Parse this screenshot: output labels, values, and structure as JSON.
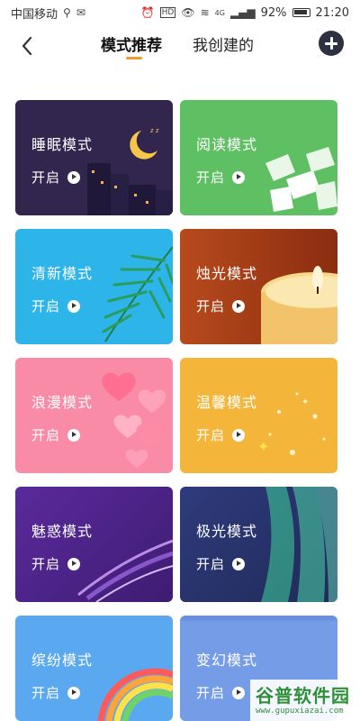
{
  "status_bar": {
    "carrier": "中国移动",
    "hd": "HD",
    "signal": "4G",
    "battery": "92%",
    "time": "21:20"
  },
  "nav": {
    "tab_recommend": "模式推荐",
    "tab_created": "我创建的",
    "accent_color": "#f39b2a"
  },
  "cards": [
    {
      "title": "睡眠模式",
      "start": "开启",
      "color": "#32264f"
    },
    {
      "title": "阅读模式",
      "start": "开启",
      "color": "#5fbf63"
    },
    {
      "title": "清新模式",
      "start": "开启",
      "color": "#2db5ea"
    },
    {
      "title": "烛光模式",
      "start": "开启",
      "color": "#b74a1c"
    },
    {
      "title": "浪漫模式",
      "start": "开启",
      "color": "#f98ba6"
    },
    {
      "title": "温馨模式",
      "start": "开启",
      "color": "#f3b63a"
    },
    {
      "title": "魅惑模式",
      "start": "开启",
      "color": "#5a2a9c"
    },
    {
      "title": "极光模式",
      "start": "开启",
      "color": "#2f3b7c"
    },
    {
      "title": "缤纷模式",
      "start": "开启",
      "color": "#5aa9f0"
    },
    {
      "title": "变幻模式",
      "start": "开启",
      "color": "#6a8fe0"
    }
  ],
  "watermark": {
    "logo": "谷普软件园",
    "url": "www.gupuxiazai.com"
  }
}
